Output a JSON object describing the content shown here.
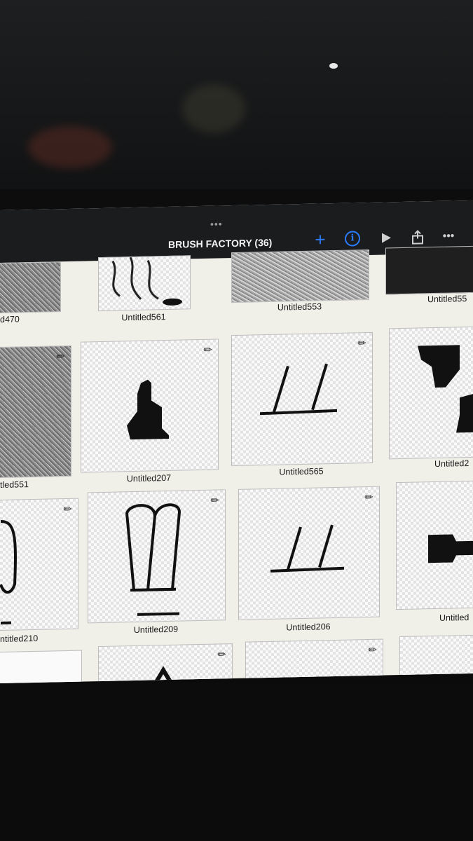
{
  "app": {
    "title": "BRUSH FACTORY (36)",
    "accent_color": "#2b7bff",
    "toolbar": {
      "grabber": "•••",
      "add_label": "+",
      "info_label": "i",
      "more_label": "•••",
      "icons": [
        "plus-icon",
        "info-icon",
        "play-icon",
        "share-icon",
        "more-icon"
      ]
    }
  },
  "brushes": [
    {
      "name": "d470"
    },
    {
      "name": "Untitled561"
    },
    {
      "name": "Untitled553"
    },
    {
      "name": "Untitled55"
    },
    {
      "name": "tled551"
    },
    {
      "name": "Untitled207"
    },
    {
      "name": "Untitled565"
    },
    {
      "name": "Untitled2"
    },
    {
      "name": "ntitled210"
    },
    {
      "name": "Untitled209"
    },
    {
      "name": "Untitled206"
    },
    {
      "name": "Untitled"
    },
    {
      "name": ""
    },
    {
      "name": ""
    },
    {
      "name": ""
    },
    {
      "name": ""
    }
  ]
}
